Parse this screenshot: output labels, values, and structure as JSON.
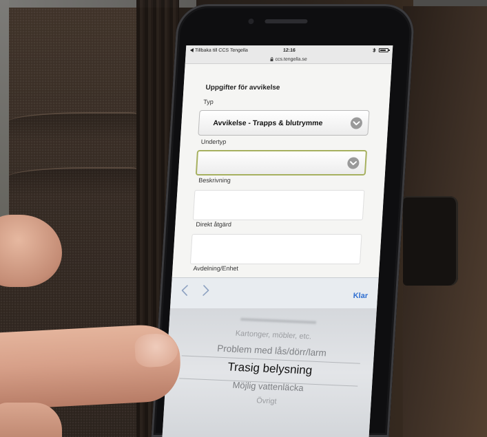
{
  "status_bar": {
    "back_label": "Tillbaka till CCS Tengella",
    "time": "12:16",
    "url": "ccs.tengella.se",
    "battery_level": 0.8
  },
  "form": {
    "heading": "Uppgifter för avvikelse",
    "type_label": "Typ",
    "type_value": "Avvikelse - Trapps & blutrymme",
    "subtype_label": "Undertyp",
    "subtype_value": "",
    "description_label": "Beskrivning",
    "description_value": "",
    "action_label": "Direkt åtgärd",
    "action_value": "",
    "department_label": "Avdelning/Enhet"
  },
  "toolbar": {
    "done_label": "Klar"
  },
  "picker": {
    "items": [
      "Kartonger, möbler, etc.",
      "Problem med lås/dörr/larm",
      "Trasig belysning",
      "Möjlig vattenläcka",
      "Övrigt"
    ],
    "selected": "Trasig belysning"
  },
  "icons": {
    "back": "back-arrow-icon",
    "lock": "lock-icon",
    "bluetooth": "bluetooth-icon",
    "battery": "battery-icon",
    "select_chevron": "chevron-down-icon",
    "prev": "chevron-left-icon",
    "next": "chevron-right-icon"
  },
  "colors": {
    "accent": "#2f6fd1",
    "focus_border": "#a6b05e",
    "toolbar_bg": "#e8ecf0",
    "screen_bg": "#f4f4f2"
  }
}
